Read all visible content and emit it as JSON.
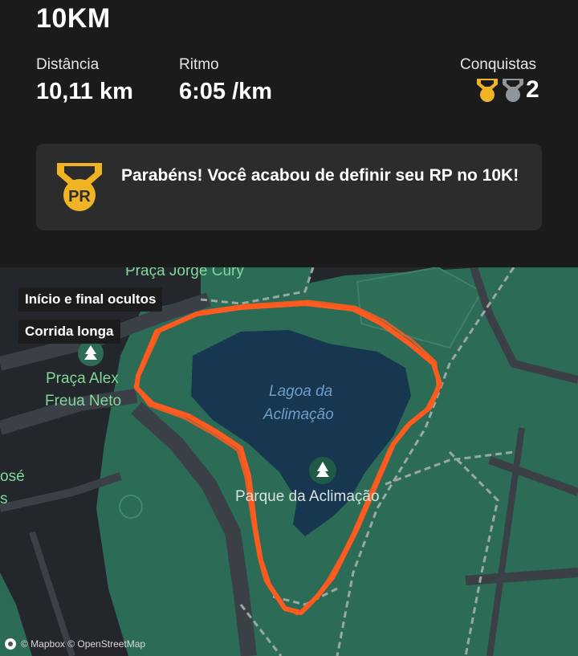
{
  "activity": {
    "title": "10KM"
  },
  "stats": [
    {
      "label": "Distância",
      "value": "10,11 km"
    },
    {
      "label": "Ritmo",
      "value": "6:05 /km"
    }
  ],
  "achievements": {
    "label": "Conquistas",
    "count": "2",
    "icons": [
      "gold-medal-icon",
      "silver-medal-icon"
    ]
  },
  "banner": {
    "icon": "pr-medal-icon",
    "text": "Parabéns! Você acabou de definir seu RP no 10K!"
  },
  "map": {
    "chips": [
      "Início e final ocultos",
      "Corrida longa"
    ],
    "labels": {
      "plaza_top": "Praça Jorge Cury",
      "plaza_left_1": "Praça Alex",
      "plaza_left_2": "Freua Neto",
      "lake_1": "Lagoa da",
      "lake_2": "Aclimação",
      "park": "Parque da Aclimação",
      "edge_1": "osé",
      "edge_2": "s"
    },
    "attribution": "© Mapbox © OpenStreetMap",
    "colors": {
      "route": "#ff5a1f",
      "park": "#2c6b55",
      "water": "#17364f",
      "accent_medal": "#f0b323"
    }
  }
}
